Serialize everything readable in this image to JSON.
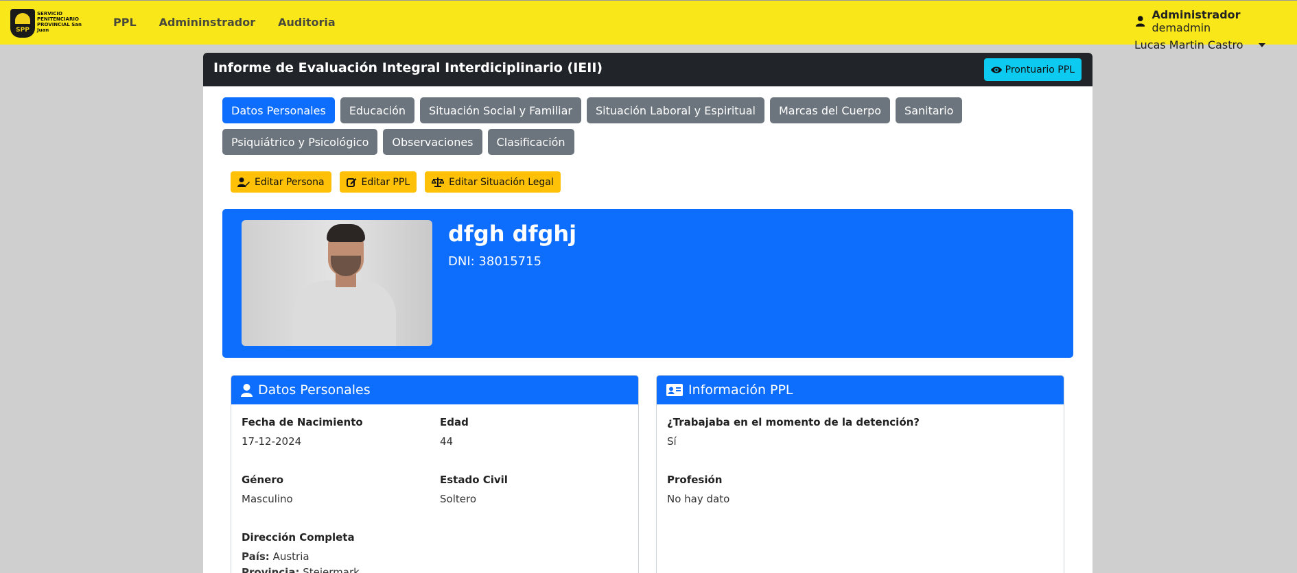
{
  "navbar": {
    "logo_text": "SERVICIO PENITENCIARIO PROVINCIAL San Juan",
    "logo_badge": "SPP",
    "links": [
      "PPL",
      "Admininstrador",
      "Auditoria"
    ],
    "user_role": "Administrador",
    "username": "demadmin",
    "full_name": "Lucas Martin Castro"
  },
  "card": {
    "title": "Informe de Evaluación Integral Interdiciplinario (IEII)",
    "prontuario_button": "Prontuario PPL"
  },
  "tabs": [
    {
      "label": "Datos Personales",
      "active": true
    },
    {
      "label": "Educación",
      "active": false
    },
    {
      "label": "Situación Social y Familiar",
      "active": false
    },
    {
      "label": "Situación Laboral y Espiritual",
      "active": false
    },
    {
      "label": "Marcas del Cuerpo",
      "active": false
    },
    {
      "label": "Sanitario",
      "active": false
    },
    {
      "label": "Psiquiátrico y Psicológico",
      "active": false
    },
    {
      "label": "Observaciones",
      "active": false
    },
    {
      "label": "Clasificación",
      "active": false
    }
  ],
  "actions": {
    "edit_persona": "Editar Persona",
    "edit_ppl": "Editar PPL",
    "edit_legal": "Editar Situación Legal"
  },
  "person": {
    "name": "dfgh dfghj",
    "dni": "DNI: 38015715"
  },
  "datos_personales": {
    "title": "Datos Personales",
    "fecha_label": "Fecha de Nacimiento",
    "fecha_value": "17-12-2024",
    "edad_label": "Edad",
    "edad_value": "44",
    "genero_label": "Género",
    "genero_value": "Masculino",
    "estado_label": "Estado Civil",
    "estado_value": "Soltero",
    "direccion_label": "Dirección Completa",
    "pais_label": "País:",
    "pais_value": "Austria",
    "provincia_label": "Provincia:",
    "provincia_value": "Steiermark"
  },
  "informacion_ppl": {
    "title": "Información PPL",
    "trabajaba_label": "¿Trabajaba en el momento de la detención?",
    "trabajaba_value": "Sí",
    "profesion_label": "Profesión",
    "profesion_value": "No hay dato"
  },
  "colors": {
    "navbar": "#fae71a",
    "primary": "#0d6efd",
    "secondary": "#6c757d",
    "warning": "#ffc107",
    "info": "#0dcaf0",
    "dark": "#212529"
  }
}
